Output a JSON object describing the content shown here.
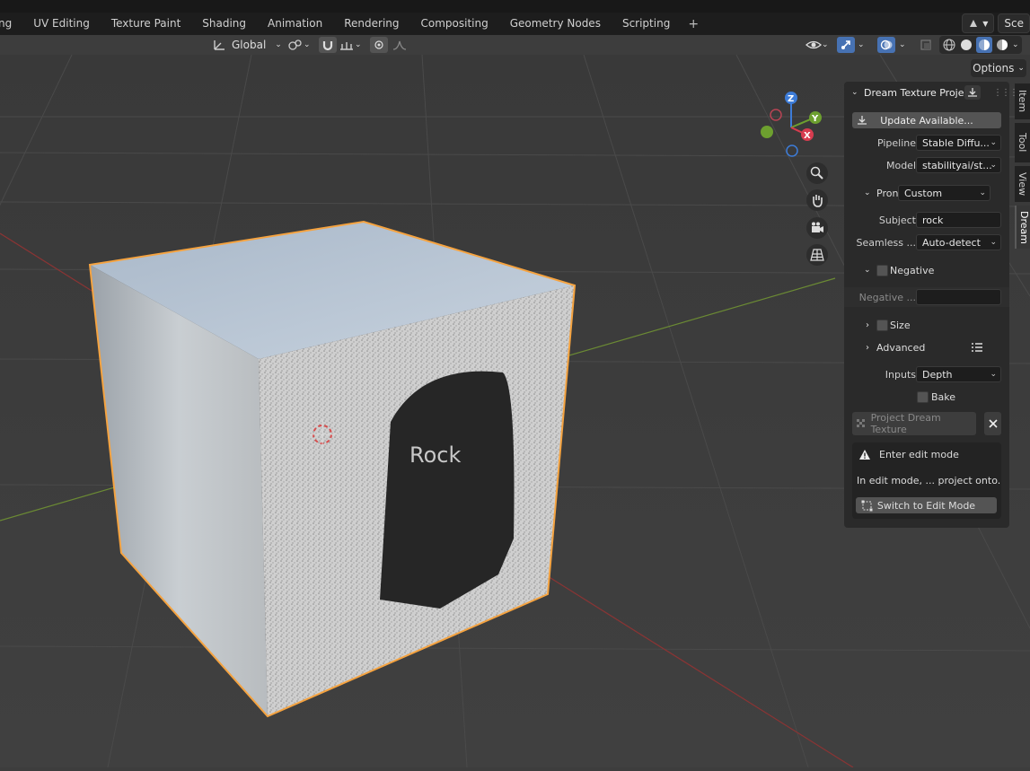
{
  "workspace_tabs": [
    "ng",
    "UV Editing",
    "Texture Paint",
    "Shading",
    "Animation",
    "Rendering",
    "Compositing",
    "Geometry Nodes",
    "Scripting"
  ],
  "add_workspace": "+",
  "scene_label": "Sce",
  "header": {
    "transform_orientation": "Global"
  },
  "options_label": "Options",
  "gizmo": {
    "z": "Z",
    "y": "Y",
    "x": "X"
  },
  "panel": {
    "title": "Dream Texture Projec",
    "update_button": "Update Available...",
    "pipeline_label": "Pipeline",
    "pipeline_value": "Stable Diffu...",
    "model_label": "Model",
    "model_value": "stabilityai/st...",
    "prompt_label": "Pron",
    "prompt_value": "Custom",
    "subject_label": "Subject",
    "subject_value": "rock",
    "seamless_label": "Seamless ...",
    "seamless_value": "Auto-detect",
    "negative_label": "Negative",
    "negative_field_label": "Negative ...",
    "size_label": "Size",
    "advanced_label": "Advanced",
    "inputs_label": "Inputs",
    "inputs_value": "Depth",
    "bake_label": "Bake",
    "project_button": "Project Dream Texture",
    "warning_title": "Enter edit mode",
    "warning_text": "In edit mode, ... project onto.",
    "switch_button": "Switch to Edit Mode"
  },
  "side_tabs": [
    "Item",
    "Tool",
    "View",
    "Dream"
  ],
  "texture_text": "Rock"
}
